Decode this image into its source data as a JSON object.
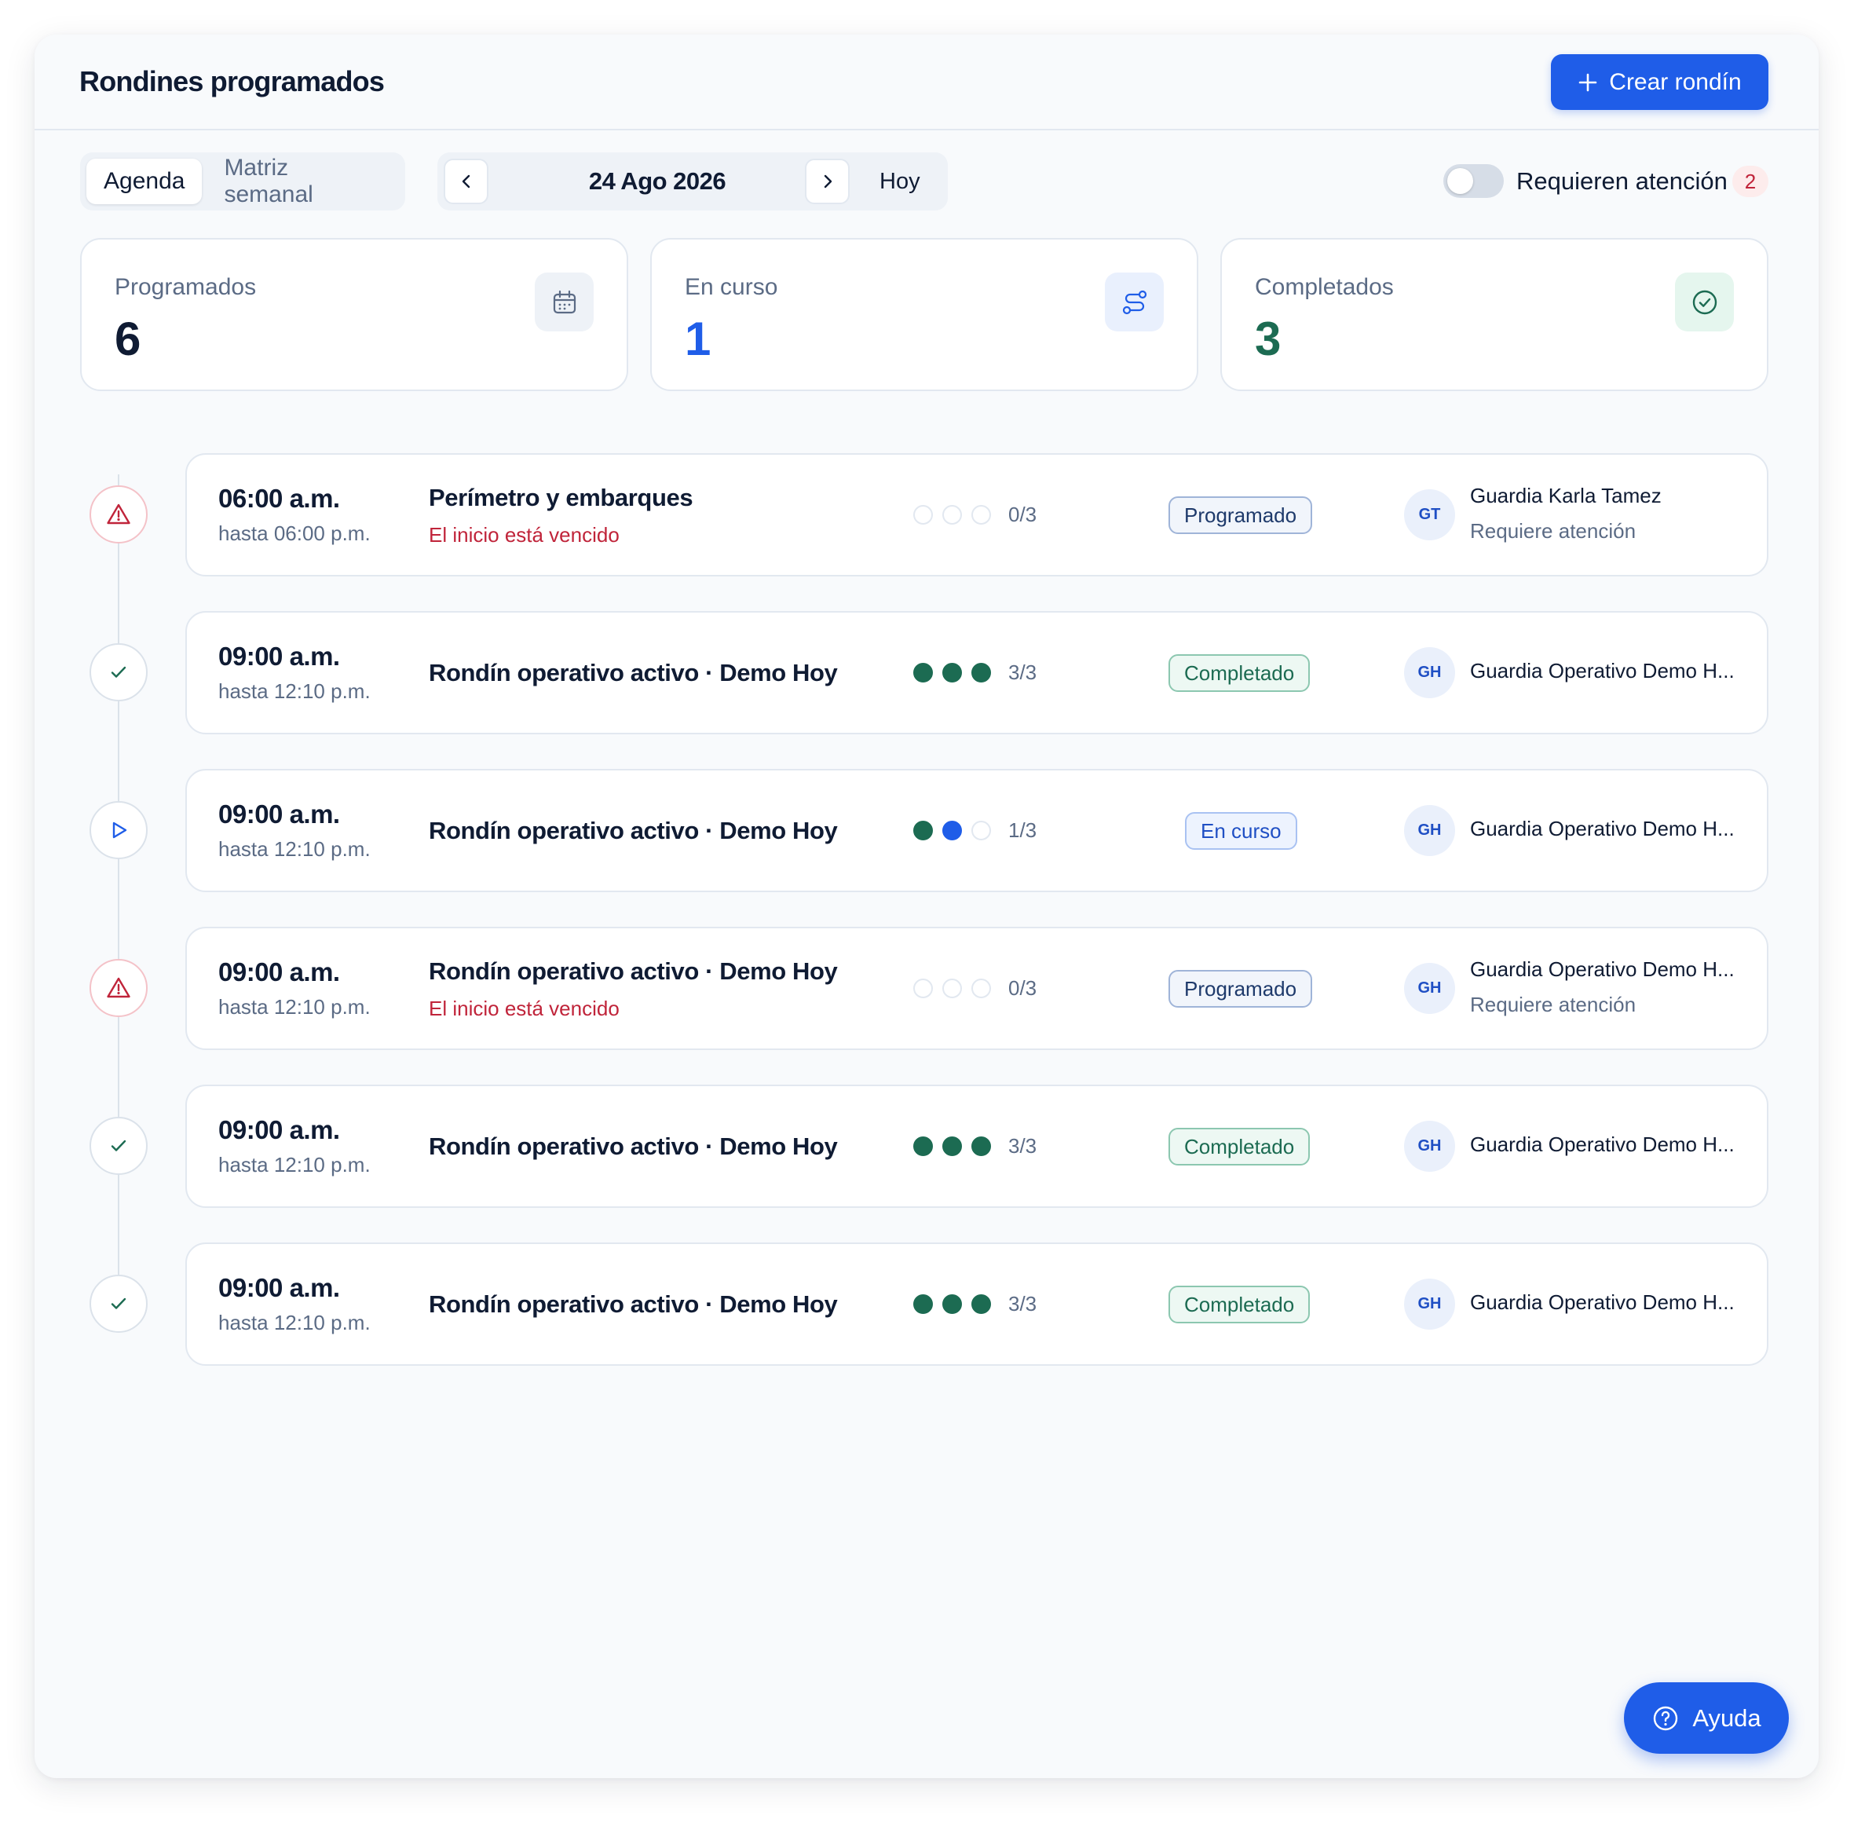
{
  "header": {
    "title": "Rondines programados",
    "create_button": "Crear rondín"
  },
  "toolbar": {
    "view_tabs": [
      {
        "label": "Agenda",
        "active": true
      },
      {
        "label": "Matriz semanal",
        "active": false
      }
    ],
    "date": "24 Ago 2026",
    "today_label": "Hoy",
    "attention_toggle": {
      "label": "Requieren atención",
      "on": false,
      "count": "2"
    }
  },
  "stats": [
    {
      "label": "Programados",
      "value": "6",
      "icon": "calendar-icon",
      "color": "#0f1b33"
    },
    {
      "label": "En curso",
      "value": "1",
      "icon": "route-icon",
      "color": "#1f5de8"
    },
    {
      "label": "Completados",
      "value": "3",
      "icon": "check-circle-icon",
      "color": "#1c6b52"
    }
  ],
  "rounds": [
    {
      "time": "06:00 a.m.",
      "until": "hasta 06:00 p.m.",
      "name": "Perímetro y embarques",
      "warning": "El inicio está vencido",
      "progress_done": 0,
      "progress_active": 0,
      "progress_total": 3,
      "count": "0/3",
      "status": "Programado",
      "status_kind": "prog",
      "node": "alert",
      "avatar": "GT",
      "guard": "Guardia Karla Tamez",
      "guard_sub": "Requiere atención"
    },
    {
      "time": "09:00 a.m.",
      "until": "hasta 12:10 p.m.",
      "name": "Rondín operativo activo · Demo Hoy",
      "warning": "",
      "progress_done": 3,
      "progress_active": 0,
      "progress_total": 3,
      "count": "3/3",
      "status": "Completado",
      "status_kind": "done",
      "node": "check",
      "avatar": "GH",
      "guard": "Guardia Operativo Demo H...",
      "guard_sub": ""
    },
    {
      "time": "09:00 a.m.",
      "until": "hasta 12:10 p.m.",
      "name": "Rondín operativo activo · Demo Hoy",
      "warning": "",
      "progress_done": 1,
      "progress_active": 1,
      "progress_total": 3,
      "count": "1/3",
      "status": "En curso",
      "status_kind": "run",
      "node": "play",
      "avatar": "GH",
      "guard": "Guardia Operativo Demo H...",
      "guard_sub": ""
    },
    {
      "time": "09:00 a.m.",
      "until": "hasta 12:10 p.m.",
      "name": "Rondín operativo activo · Demo Hoy",
      "warning": "El inicio está vencido",
      "progress_done": 0,
      "progress_active": 0,
      "progress_total": 3,
      "count": "0/3",
      "status": "Programado",
      "status_kind": "prog",
      "node": "alert",
      "avatar": "GH",
      "guard": "Guardia Operativo Demo H...",
      "guard_sub": "Requiere atención"
    },
    {
      "time": "09:00 a.m.",
      "until": "hasta 12:10 p.m.",
      "name": "Rondín operativo activo · Demo Hoy",
      "warning": "",
      "progress_done": 3,
      "progress_active": 0,
      "progress_total": 3,
      "count": "3/3",
      "status": "Completado",
      "status_kind": "done",
      "node": "check",
      "avatar": "GH",
      "guard": "Guardia Operativo Demo H...",
      "guard_sub": ""
    },
    {
      "time": "09:00 a.m.",
      "until": "hasta 12:10 p.m.",
      "name": "Rondín operativo activo · Demo Hoy",
      "warning": "",
      "progress_done": 3,
      "progress_active": 0,
      "progress_total": 3,
      "count": "3/3",
      "status": "Completado",
      "status_kind": "done",
      "node": "check",
      "avatar": "GH",
      "guard": "Guardia Operativo Demo H...",
      "guard_sub": ""
    }
  ],
  "help_button": "Ayuda",
  "colors": {
    "accent": "#1f5de8",
    "success": "#1c6b52",
    "danger": "#c0243a"
  }
}
